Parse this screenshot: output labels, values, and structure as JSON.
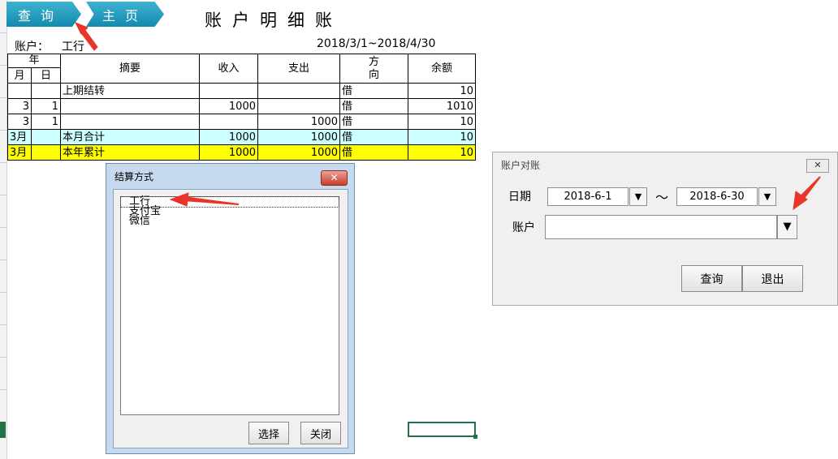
{
  "toolbar": {
    "query_label": "查询",
    "home_label": "主页"
  },
  "sheet": {
    "title": "账户明细账",
    "account_label": "账户：",
    "account_value": "工行",
    "date_range": "2018/3/1~2018/4/30"
  },
  "table": {
    "headers": {
      "year": "年",
      "month": "月",
      "day": "日",
      "summary": "摘要",
      "income": "收入",
      "expense": "支出",
      "direction_1": "方",
      "direction_2": "向",
      "balance": "余额"
    },
    "rows": [
      {
        "month": "",
        "day": "",
        "summary": "上期结转",
        "income": "",
        "expense": "",
        "direction": "借",
        "balance": "10"
      },
      {
        "month": "3",
        "day": "1",
        "summary": "",
        "income": "1000",
        "expense": "",
        "direction": "借",
        "balance": "1010"
      },
      {
        "month": "3",
        "day": "1",
        "summary": "",
        "income": "",
        "expense": "1000",
        "direction": "借",
        "balance": "10"
      },
      {
        "month": "3月",
        "day": "",
        "summary": "本月合计",
        "income": "1000",
        "expense": "1000",
        "direction": "借",
        "balance": "10"
      },
      {
        "month": "3月",
        "day": "",
        "summary": "本年累计",
        "income": "1000",
        "expense": "1000",
        "direction": "借",
        "balance": "10"
      }
    ],
    "row_colors": {
      "month_total": "#ccffff",
      "year_total": "#ffff00"
    }
  },
  "settle_dialog": {
    "title": "结算方式",
    "close_glyph": "✕",
    "options": [
      "工行",
      "支付宝",
      "微信"
    ],
    "select_label": "选择",
    "close_label": "关闭"
  },
  "recon_dialog": {
    "title": "账户对账",
    "close_glyph": "✕",
    "date_label": "日期",
    "date_from": "2018-6-1",
    "date_sep": "～",
    "date_to": "2018-6-30",
    "account_label": "账户",
    "account_value": "",
    "dropdown_glyph": "▼",
    "query_label": "查询",
    "exit_label": "退出"
  },
  "colors": {
    "accent_teal": "#1b93b8",
    "arrow_red": "#e8352a",
    "selection_green": "#217346"
  }
}
